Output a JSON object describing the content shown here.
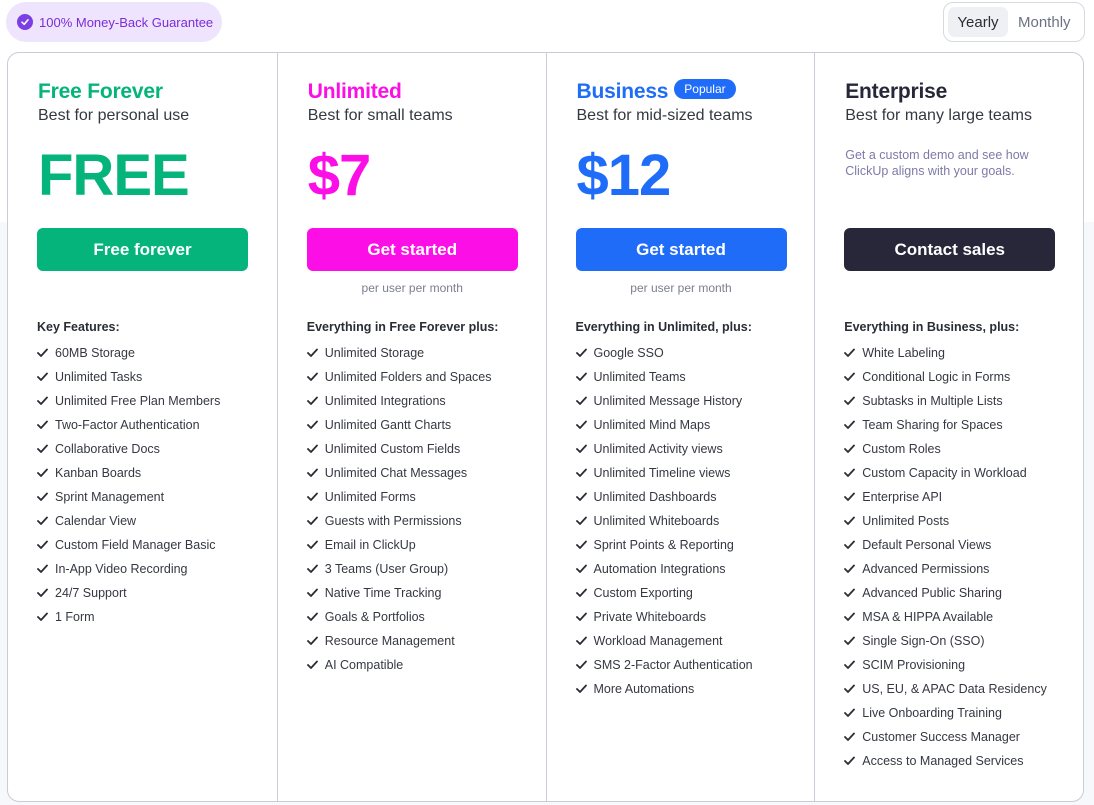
{
  "guarantee": {
    "label": "100% Money-Back Guarantee",
    "icon": "check-circle-icon"
  },
  "billing_toggle": {
    "options": [
      "Yearly",
      "Monthly"
    ],
    "selected": "Yearly"
  },
  "colors": {
    "free": "#05b47a",
    "unlimited": "#fc0ee6",
    "business": "#1f6cf9",
    "enterprise": "#272739"
  },
  "plans": [
    {
      "name": "Free Forever",
      "subtitle": "Best for personal use",
      "price": "FREE",
      "cta": "Free forever",
      "features_title": "Key Features:",
      "features": [
        "60MB Storage",
        "Unlimited Tasks",
        "Unlimited Free Plan Members",
        "Two-Factor Authentication",
        "Collaborative Docs",
        "Kanban Boards",
        "Sprint Management",
        "Calendar View",
        "Custom Field Manager Basic",
        "In-App Video Recording",
        "24/7 Support",
        "1 Form"
      ]
    },
    {
      "name": "Unlimited",
      "subtitle": "Best for small teams",
      "price": "$7",
      "cta": "Get started",
      "per_user": "per user per month",
      "features_title": "Everything in Free Forever plus:",
      "features": [
        "Unlimited Storage",
        "Unlimited Folders and Spaces",
        "Unlimited Integrations",
        "Unlimited Gantt Charts",
        "Unlimited Custom Fields",
        "Unlimited Chat Messages",
        "Unlimited Forms",
        "Guests with Permissions",
        "Email in ClickUp",
        "3 Teams (User Group)",
        "Native Time Tracking",
        "Goals & Portfolios",
        "Resource Management",
        "AI Compatible"
      ]
    },
    {
      "name": "Business",
      "badge": "Popular",
      "subtitle": "Best for mid-sized teams",
      "price": "$12",
      "cta": "Get started",
      "per_user": "per user per month",
      "features_title": "Everything in Unlimited, plus:",
      "features": [
        "Google SSO",
        "Unlimited Teams",
        "Unlimited Message History",
        "Unlimited Mind Maps",
        "Unlimited Activity views",
        "Unlimited Timeline views",
        "Unlimited Dashboards",
        "Unlimited Whiteboards",
        "Sprint Points & Reporting",
        "Automation Integrations",
        "Custom Exporting",
        "Private Whiteboards",
        "Workload Management",
        "SMS 2-Factor Authentication",
        "More Automations"
      ]
    },
    {
      "name": "Enterprise",
      "subtitle": "Best for many large teams",
      "description": "Get a custom demo and see how ClickUp aligns with your goals.",
      "cta": "Contact sales",
      "features_title": "Everything in Business, plus:",
      "features": [
        "White Labeling",
        "Conditional Logic in Forms",
        "Subtasks in Multiple Lists",
        "Team Sharing for Spaces",
        "Custom Roles",
        "Custom Capacity in Workload",
        "Enterprise API",
        "Unlimited Posts",
        "Default Personal Views",
        "Advanced Permissions",
        "Advanced Public Sharing",
        "MSA & HIPPA Available",
        "Single Sign-On (SSO)",
        "SCIM Provisioning",
        "US, EU, & APAC Data Residency",
        "Live Onboarding Training",
        "Customer Success Manager",
        "Access to Managed Services"
      ]
    }
  ]
}
